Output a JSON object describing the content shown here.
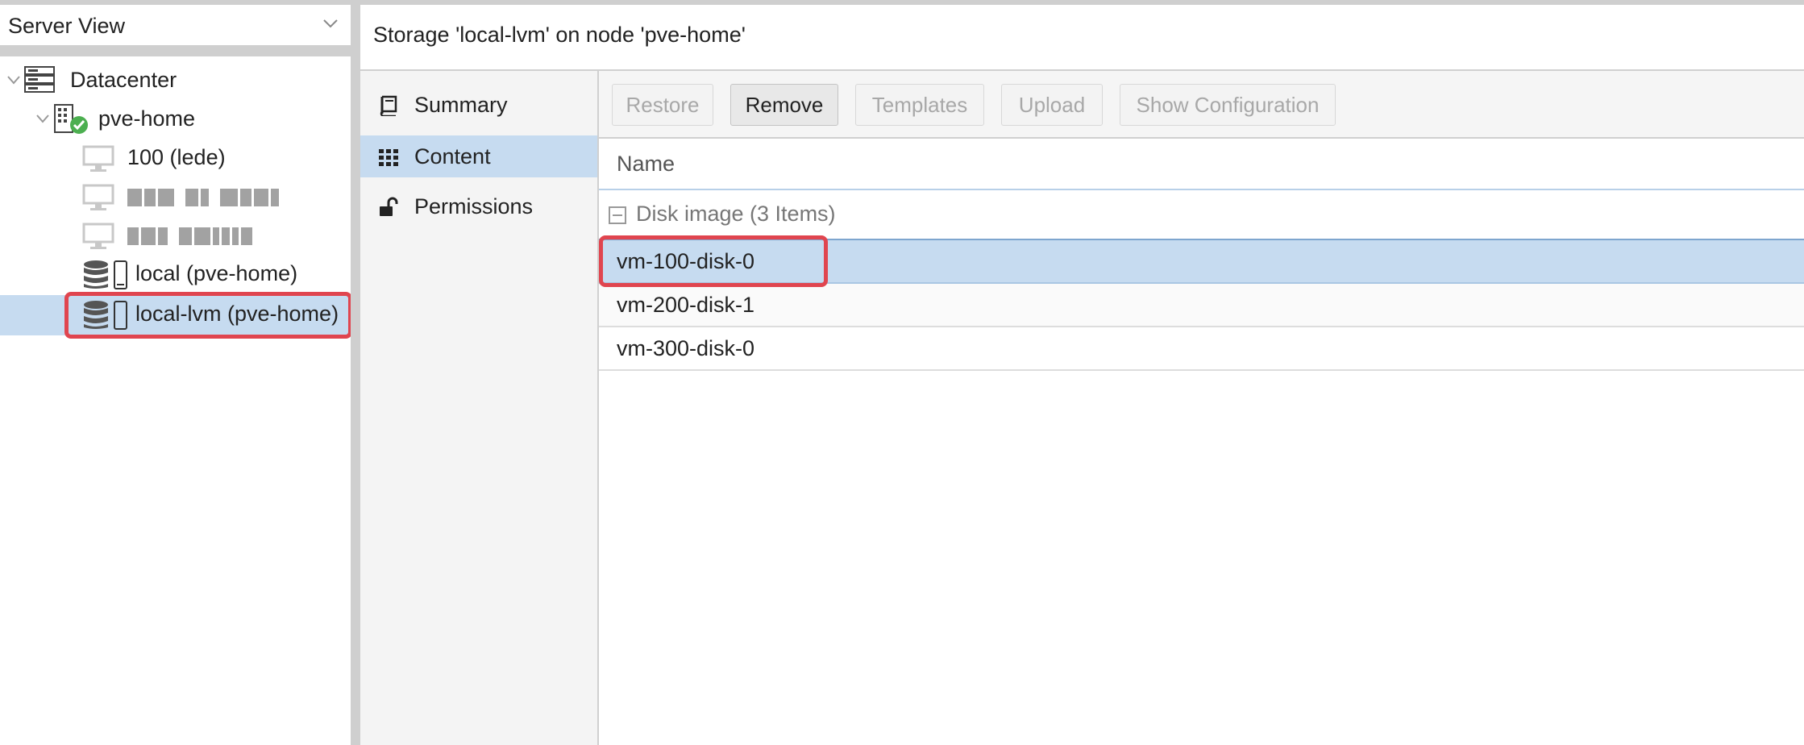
{
  "view_selector": {
    "label": "Server View"
  },
  "tree": {
    "datacenter": "Datacenter",
    "node": "pve-home",
    "vm_100": "100 (lede)",
    "storage_local": "local (pve-home)",
    "storage_local_lvm": "local-lvm (pve-home)"
  },
  "header": {
    "title": "Storage 'local-lvm' on node 'pve-home'"
  },
  "nav": [
    {
      "label": "Summary",
      "icon": "book-icon"
    },
    {
      "label": "Content",
      "icon": "grid-icon"
    },
    {
      "label": "Permissions",
      "icon": "unlock-icon"
    }
  ],
  "toolbar": {
    "restore": "Restore",
    "remove": "Remove",
    "templates": "Templates",
    "upload": "Upload",
    "show_config": "Show Configuration"
  },
  "grid": {
    "column_name": "Name",
    "group_label": "Disk image (3 Items)",
    "rows": [
      "vm-100-disk-0",
      "vm-200-disk-1",
      "vm-300-disk-0"
    ]
  },
  "colors": {
    "selection": "#c6dbf0",
    "highlight": "#e0454f",
    "ok_badge": "#4caf50"
  }
}
